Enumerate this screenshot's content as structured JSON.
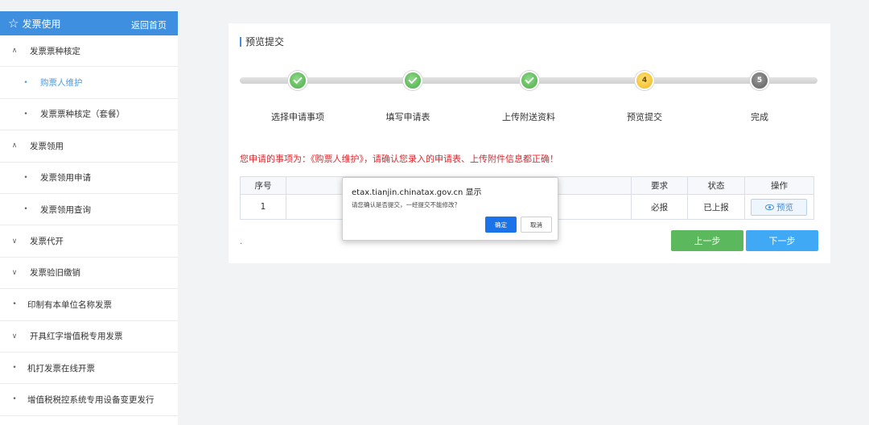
{
  "sidebar": {
    "title": "发票使用",
    "home_link": "返回首页",
    "items": [
      {
        "label": "发票票种核定",
        "mark": "∧"
      },
      {
        "label": "购票人维护",
        "mark": "•"
      },
      {
        "label": "发票票种核定（套餐）",
        "mark": "•"
      },
      {
        "label": "发票领用",
        "mark": "∧"
      },
      {
        "label": "发票领用申请",
        "mark": "•"
      },
      {
        "label": "发票领用查询",
        "mark": "•"
      },
      {
        "label": "发票代开",
        "mark": "∨"
      },
      {
        "label": "发票验旧缴销",
        "mark": "∨"
      },
      {
        "label": "印制有本单位名称发票",
        "mark": "•"
      },
      {
        "label": "开具红字增值税专用发票",
        "mark": "∨"
      },
      {
        "label": "机打发票在线开票",
        "mark": "•"
      },
      {
        "label": "增值税税控系统专用设备变更发行",
        "mark": "•"
      }
    ]
  },
  "panel": {
    "title": "预览提交",
    "steps": [
      {
        "label": "选择申请事项",
        "state": "done"
      },
      {
        "label": "填写申请表",
        "state": "done"
      },
      {
        "label": "上传附送资料",
        "state": "done"
      },
      {
        "label": "预览提交",
        "state": "current",
        "number": "4"
      },
      {
        "label": "完成",
        "state": "todo",
        "number": "5"
      }
    ],
    "notice": "您申请的事项为：《购票人维护》，请确认您录入的申请表、上传附件信息都正确！",
    "table": {
      "headers": [
        "序号",
        "",
        "要求",
        "状态",
        "操作"
      ],
      "rows": [
        {
          "index": "1",
          "name": "",
          "requirement": "必报",
          "status": "已上报",
          "action": "预览"
        }
      ]
    },
    "footnote": ".",
    "prev_button": "上一步",
    "next_button": "下一步"
  },
  "dialog": {
    "host": "etax.tianjin.chinatax.gov.cn 显示",
    "message": "请您确认是否提交，一经提交不能修改？",
    "ok": "确定",
    "cancel": "取消"
  },
  "colors": {
    "accent": "#3f8fe0",
    "done": "#4aad45",
    "current": "#f2b519",
    "todo": "#5d5d5d",
    "notice": "#e0252b",
    "prev": "#5cb85c",
    "next": "#3fa9f5"
  }
}
